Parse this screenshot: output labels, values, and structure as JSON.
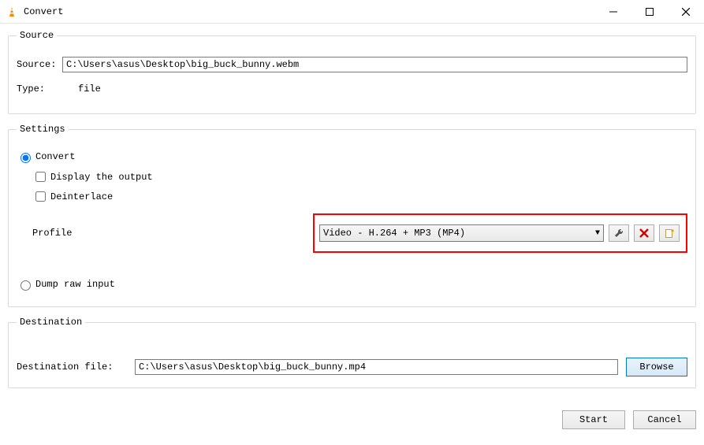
{
  "window": {
    "title": "Convert",
    "min_label": "Minimize",
    "max_label": "Maximize",
    "close_label": "Close"
  },
  "source": {
    "legend": "Source",
    "source_label": "Source:",
    "source_value": "C:\\Users\\asus\\Desktop\\big_buck_bunny.webm",
    "type_label": "Type:",
    "type_value": "file"
  },
  "settings": {
    "legend": "Settings",
    "convert_label": "Convert",
    "convert_checked": true,
    "display_output_label": "Display the output",
    "display_output_checked": false,
    "deinterlace_label": "Deinterlace",
    "deinterlace_checked": false,
    "profile_label": "Profile",
    "profile_selected": "Video - H.264 + MP3 (MP4)",
    "edit_profile_tooltip": "Edit selected profile",
    "delete_profile_tooltip": "Delete selected profile",
    "new_profile_tooltip": "Create a new profile",
    "dump_raw_label": "Dump raw input",
    "dump_raw_checked": false
  },
  "destination": {
    "legend": "Destination",
    "file_label": "Destination file:",
    "file_value": "C:\\Users\\asus\\Desktop\\big_buck_bunny.mp4",
    "browse_label": "Browse"
  },
  "footer": {
    "start_label": "Start",
    "cancel_label": "Cancel"
  }
}
